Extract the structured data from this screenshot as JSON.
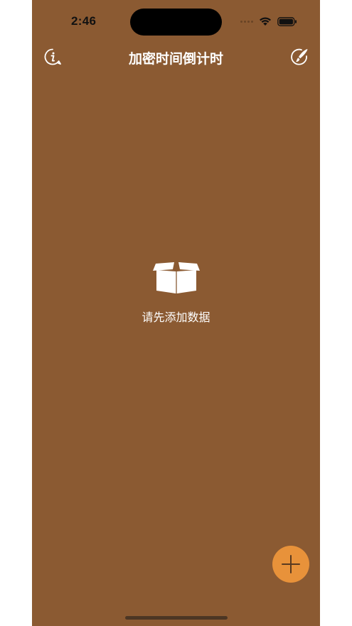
{
  "status_bar": {
    "time": "2:46",
    "wifi_icon": "wifi-icon",
    "battery_icon": "battery-icon"
  },
  "nav": {
    "title": "加密时间倒计时",
    "left_icon": "info-icon",
    "right_icon": "theme-brush-icon"
  },
  "empty_state": {
    "icon": "open-box-icon",
    "message": "请先添加数据"
  },
  "fab": {
    "icon": "plus-icon"
  },
  "colors": {
    "background": "#8B5A32",
    "fab": "#E8923A",
    "text": "#FFFFFF"
  }
}
